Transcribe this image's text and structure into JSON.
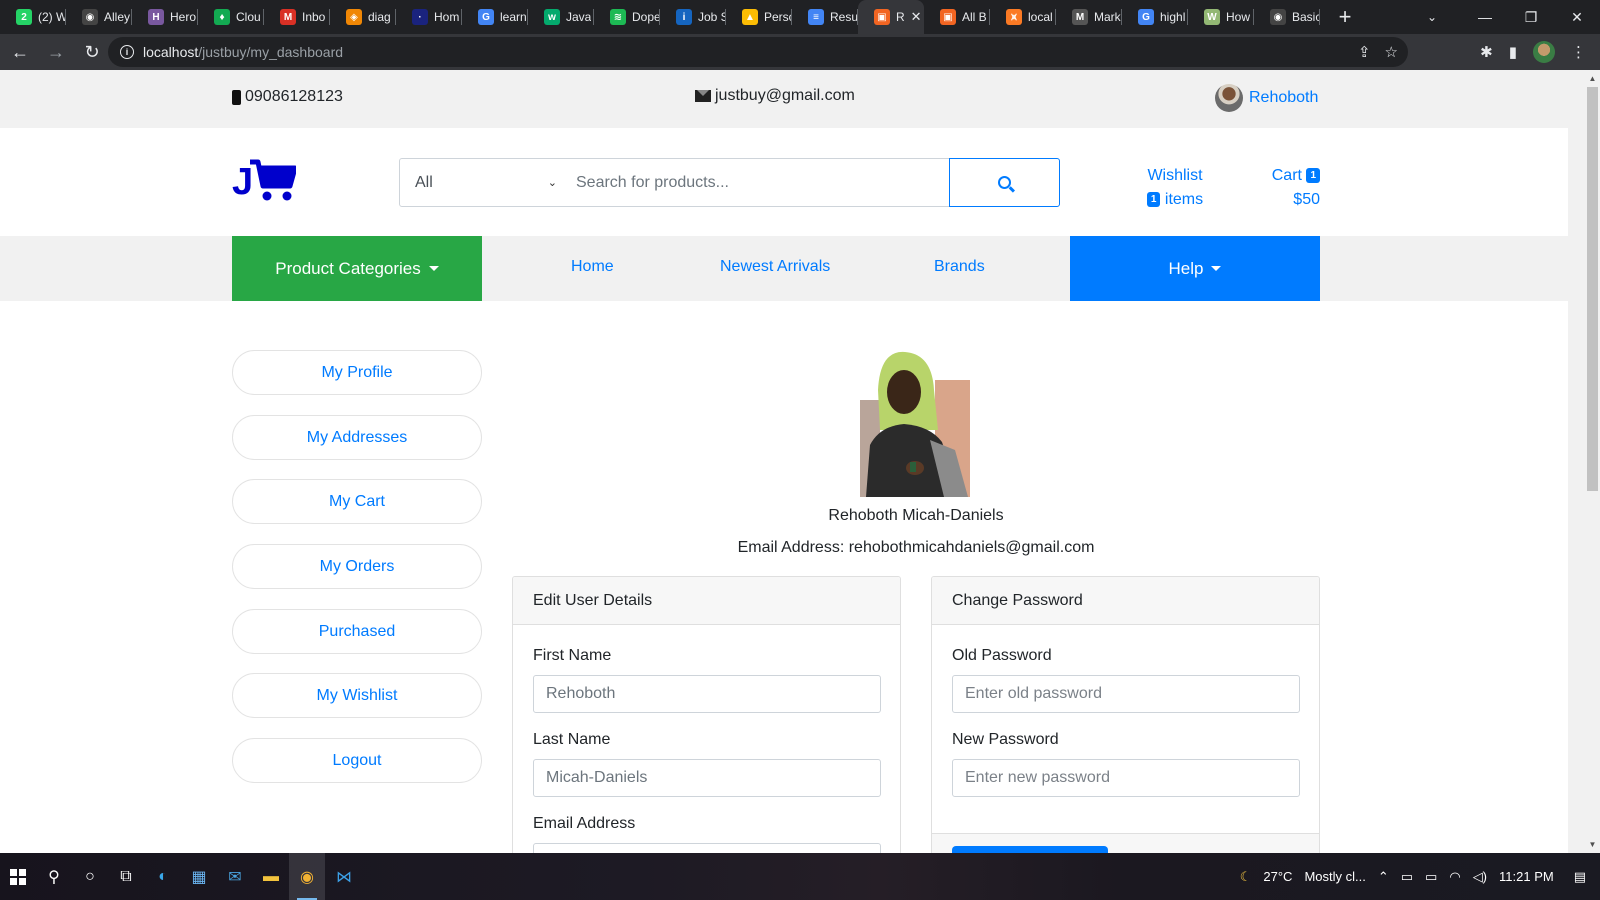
{
  "browser": {
    "tabs": [
      {
        "title": "(2) W",
        "icon": "whatsapp-icon",
        "color": "#25d366",
        "glyph": "2"
      },
      {
        "title": "Alley",
        "icon": "github-icon",
        "color": "#444",
        "glyph": "◉"
      },
      {
        "title": "Hero",
        "icon": "heroku-icon",
        "color": "#79589f",
        "glyph": "H"
      },
      {
        "title": "Clou",
        "icon": "mongodb-icon",
        "color": "#13aa52",
        "glyph": "♦"
      },
      {
        "title": "Inbo",
        "icon": "gmail-icon",
        "color": "#d93025",
        "glyph": "M"
      },
      {
        "title": "diag",
        "icon": "diagrams-icon",
        "color": "#f08705",
        "glyph": "◈"
      },
      {
        "title": "Hom",
        "icon": "home-site-icon",
        "color": "#1a237e",
        "glyph": "·"
      },
      {
        "title": "learn",
        "icon": "google-icon",
        "color": "#4285f4",
        "glyph": "G"
      },
      {
        "title": "Java",
        "icon": "w3-icon",
        "color": "#04aa6d",
        "glyph": "w"
      },
      {
        "title": "Dope",
        "icon": "spotify-icon",
        "color": "#1db954",
        "glyph": "≋"
      },
      {
        "title": "Job S",
        "icon": "job-icon",
        "color": "#1565c0",
        "glyph": "i"
      },
      {
        "title": "Perso",
        "icon": "drive-icon",
        "color": "#fbbc04",
        "glyph": "▲"
      },
      {
        "title": "Resu",
        "icon": "docs-icon",
        "color": "#4285f4",
        "glyph": "≡"
      },
      {
        "title": "R",
        "icon": "app-icon",
        "color": "#f26522",
        "glyph": "▣",
        "active": true
      },
      {
        "title": "All B",
        "icon": "app-icon",
        "color": "#f26522",
        "glyph": "▣"
      },
      {
        "title": "local",
        "icon": "xampp-icon",
        "color": "#fb7a24",
        "glyph": "⩙"
      },
      {
        "title": "Mark",
        "icon": "markdown-icon",
        "color": "#555",
        "glyph": "M"
      },
      {
        "title": "highl",
        "icon": "google-icon",
        "color": "#4285f4",
        "glyph": "G"
      },
      {
        "title": "How",
        "icon": "wikihow-icon",
        "color": "#93b874",
        "glyph": "W"
      },
      {
        "title": "Basic",
        "icon": "github-icon",
        "color": "#444",
        "glyph": "◉"
      }
    ],
    "url_host": "localhost",
    "url_path": "/justbuy/my_dashboard"
  },
  "topbar": {
    "phone": "09086128123",
    "email": "justbuy@gmail.com",
    "username": "Rehoboth"
  },
  "header": {
    "logo_letter": "J",
    "category_select": "All",
    "search_placeholder": "Search for products...",
    "wishlist_label": "Wishlist",
    "wishlist_count": "1",
    "wishlist_items_label": "items",
    "cart_label": "Cart",
    "cart_count": "1",
    "cart_total": "$50"
  },
  "nav": {
    "categories": "Product Categories",
    "home": "Home",
    "newest": "Newest Arrivals",
    "brands": "Brands",
    "help": "Help"
  },
  "sidebar": {
    "items": [
      {
        "label": "My Profile"
      },
      {
        "label": "My Addresses"
      },
      {
        "label": "My Cart"
      },
      {
        "label": "My Orders"
      },
      {
        "label": "Purchased"
      },
      {
        "label": "My Wishlist"
      },
      {
        "label": "Logout"
      }
    ]
  },
  "profile": {
    "name": "Rehoboth Micah-Daniels",
    "email_line": "Email Address: rehobothmicahdaniels@gmail.com"
  },
  "edit_card": {
    "title": "Edit User Details",
    "first_name_label": "First Name",
    "first_name_value": "Rehoboth",
    "last_name_label": "Last Name",
    "last_name_value": "Micah-Daniels",
    "email_label": "Email Address"
  },
  "password_card": {
    "title": "Change Password",
    "old_label": "Old Password",
    "old_placeholder": "Enter old password",
    "new_label": "New Password",
    "new_placeholder": "Enter new password"
  },
  "taskbar": {
    "temperature": "27°C",
    "weather": "Mostly cl...",
    "time": "11:21 PM"
  },
  "colors": {
    "primary": "#007bff",
    "success": "#28a745",
    "logo": "#0000cc"
  }
}
